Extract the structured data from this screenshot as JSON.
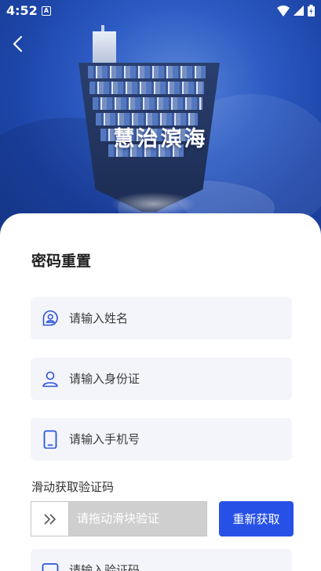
{
  "status_bar": {
    "time": "4:52",
    "notification_icon": "A"
  },
  "header": {
    "brand_title": "慧治滨海",
    "back_icon": "chevron-left-icon"
  },
  "form": {
    "title": "密码重置",
    "name_field": {
      "placeholder": "请输入姓名",
      "icon": "user-badge-icon"
    },
    "id_field": {
      "placeholder": "请输入身份证",
      "icon": "person-icon"
    },
    "phone_field": {
      "placeholder": "请输入手机号",
      "icon": "phone-icon"
    },
    "slide_verify": {
      "label": "滑动获取验证码",
      "hint": "请拖动滑块验证",
      "handle_icon": "double-chevron-right-icon"
    },
    "refresh_button": "重新获取",
    "code_field": {
      "placeholder": "请输入验证码",
      "icon": "message-icon"
    }
  },
  "colors": {
    "primary": "#2751e6",
    "icon_blue": "#2a55d9",
    "field_bg": "#f4f5fa",
    "slider_bg": "#cfcfcf"
  }
}
